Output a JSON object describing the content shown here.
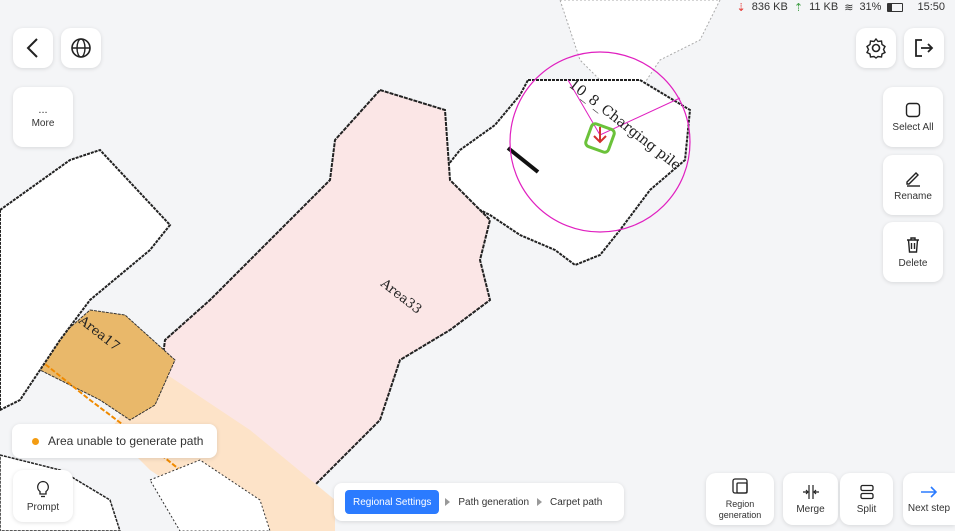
{
  "status_bar": {
    "download": "836 KB",
    "upload": "11 KB",
    "battery": "31%",
    "time": "15:50"
  },
  "toolbar": {
    "more_label": "More",
    "more_dots": "...",
    "select_all_label": "Select All",
    "rename_label": "Rename",
    "delete_label": "Delete",
    "prompt_label": "Prompt",
    "region_generation_label": "Region generation",
    "merge_label": "Merge",
    "split_label": "Split",
    "next_step_label": "Next step"
  },
  "notice": {
    "text": "Area unable to generate path",
    "dot_color": "#f39c12"
  },
  "steps": [
    "Regional Settings",
    "Path generation",
    "Carpet path"
  ],
  "map": {
    "area_main": "Area33",
    "area_warning": "Area17",
    "charging_pile": "10_8_Charging pile",
    "colors": {
      "area_main_fill": "#fbe6e6",
      "area_warning_fill": "#e9b86a",
      "path_band": "#fde3c8",
      "marker": "#e020c0",
      "robot": "#6bc23a"
    }
  },
  "icons": {
    "back": "chevron-left-icon",
    "globe": "globe-icon",
    "settings": "gear-icon",
    "exit": "exit-icon"
  },
  "accent_color": "#2b7bff"
}
